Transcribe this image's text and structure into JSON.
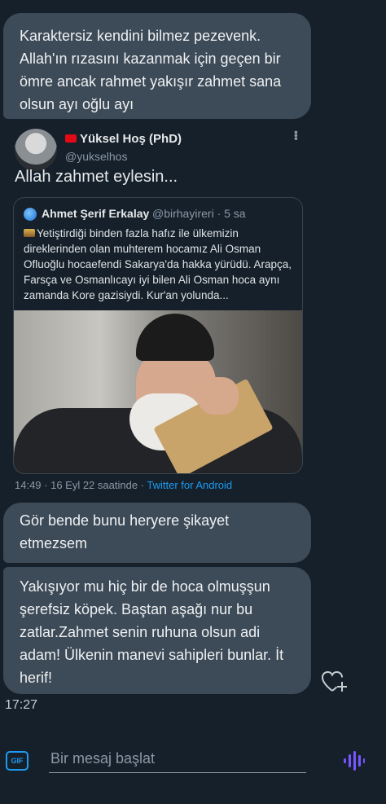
{
  "messages": [
    {
      "text": "Karaktersiz kendini bilmez pezevenk. Allah'ın rızasını kazanmak için geçen bir ömre ancak rahmet yakışır zahmet sana olsun ayı oğlu ayı"
    },
    {
      "text": "Gör bende bunu heryere şikayet etmezsem"
    },
    {
      "text": "Yakışıyor mu hiç bir de hoca olmuşşun şerefsiz köpek. Baştan aşağı nur bu zatlar.Zahmet senin ruhuna olsun adi adam! Ülkenin manevi sahipleri bunlar. İt herif!"
    }
  ],
  "shared_tweet": {
    "author_name": "Yüksel Hoş (PhD)",
    "author_handle": "@yukselhos",
    "text": "Allah zahmet eylesin...",
    "quote": {
      "author_name": "Ahmet Şerif Erkalay",
      "author_handle": "@birhayireri · 5 sa",
      "text": "Yetiştirdiği binden fazla hafız ile ülkemizin direklerinden olan muhterem hocamız Ali Osman Ofluoğlu hocaefendi Sakarya'da hakka yürüdü. Arapça, Farsça ve Osmanlıcayı iyi bilen Ali Osman hoca aynı zamanda Kore gazisiydi. Kur'an yolunda..."
    },
    "time": "14:49 · 16 Eyl 22 saatinde ·",
    "source": "Twitter for Android"
  },
  "timestamp": "17:27",
  "composer": {
    "gif_label": "GIF",
    "placeholder": "Bir mesaj başlat"
  },
  "colors": {
    "background": "#15202b",
    "bubble": "#3d4a57",
    "accent": "#1d9bf0",
    "voice": "#7856ff"
  },
  "icons": [
    "more-icon",
    "heart-plus-icon",
    "gif-icon",
    "voice-message-icon"
  ]
}
